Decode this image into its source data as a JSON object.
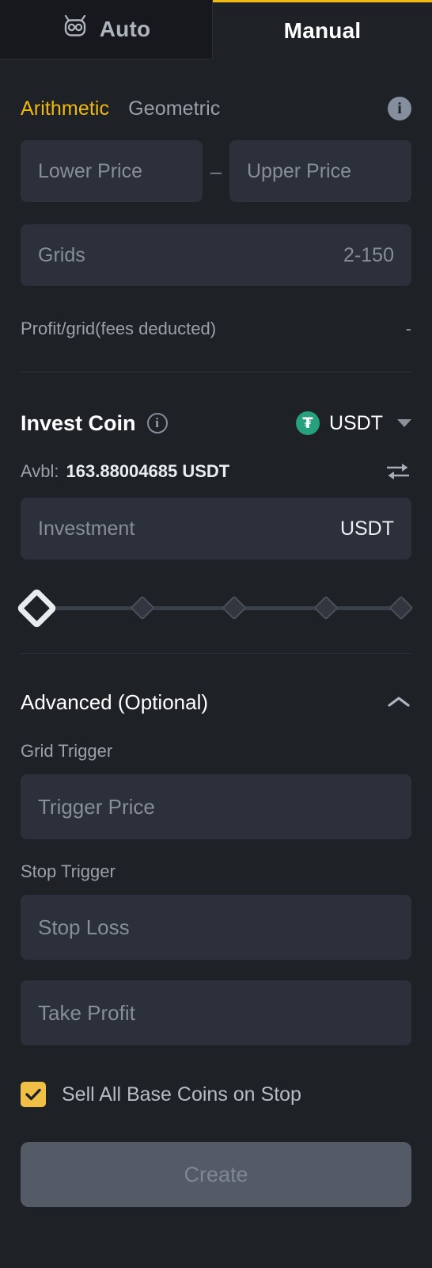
{
  "tabs": [
    {
      "id": "auto",
      "label": "Auto",
      "icon": "robot-icon",
      "active": false
    },
    {
      "id": "manual",
      "label": "Manual",
      "active": true
    }
  ],
  "mode": {
    "arithmetic_label": "Arithmetic",
    "geometric_label": "Geometric",
    "selected": "Arithmetic",
    "info_icon": "info-icon"
  },
  "price_range": {
    "lower_placeholder": "Lower Price",
    "lower_value": "",
    "separator": "–",
    "upper_placeholder": "Upper Price",
    "upper_value": ""
  },
  "grids": {
    "placeholder": "Grids",
    "value": "",
    "hint": "2-150"
  },
  "profit": {
    "label": "Profit/grid(fees deducted)",
    "value": "-"
  },
  "invest_coin": {
    "title": "Invest Coin",
    "info_icon": "info-icon",
    "coin": "USDT",
    "coin_symbol": "₮",
    "caret_icon": "chevron-down-icon"
  },
  "available": {
    "label": "Avbl:",
    "value": "163.88004685 USDT",
    "swap_icon": "swap-icon"
  },
  "investment": {
    "placeholder": "Investment",
    "value": "",
    "unit": "USDT"
  },
  "slider": {
    "value_percent": 0,
    "ticks": [
      0,
      25,
      50,
      75,
      100
    ]
  },
  "advanced": {
    "title": "Advanced (Optional)",
    "collapse_icon": "chevron-up-icon",
    "grid_trigger_label": "Grid Trigger",
    "trigger_price_placeholder": "Trigger Price",
    "trigger_price_value": "",
    "stop_trigger_label": "Stop Trigger",
    "stop_loss_placeholder": "Stop Loss",
    "stop_loss_value": "",
    "take_profit_placeholder": "Take Profit",
    "take_profit_value": ""
  },
  "sell_all": {
    "label": "Sell All Base Coins on Stop",
    "checked": true
  },
  "create": {
    "label": "Create",
    "disabled": true
  },
  "colors": {
    "accent": "#f0b90b",
    "checkbox": "#f0c046",
    "page_bg": "#1e2126",
    "field_bg": "#2b303a",
    "tether_green": "#26a17b",
    "muted_text": "#9aa1ab",
    "disabled_btn": "#545a66"
  }
}
